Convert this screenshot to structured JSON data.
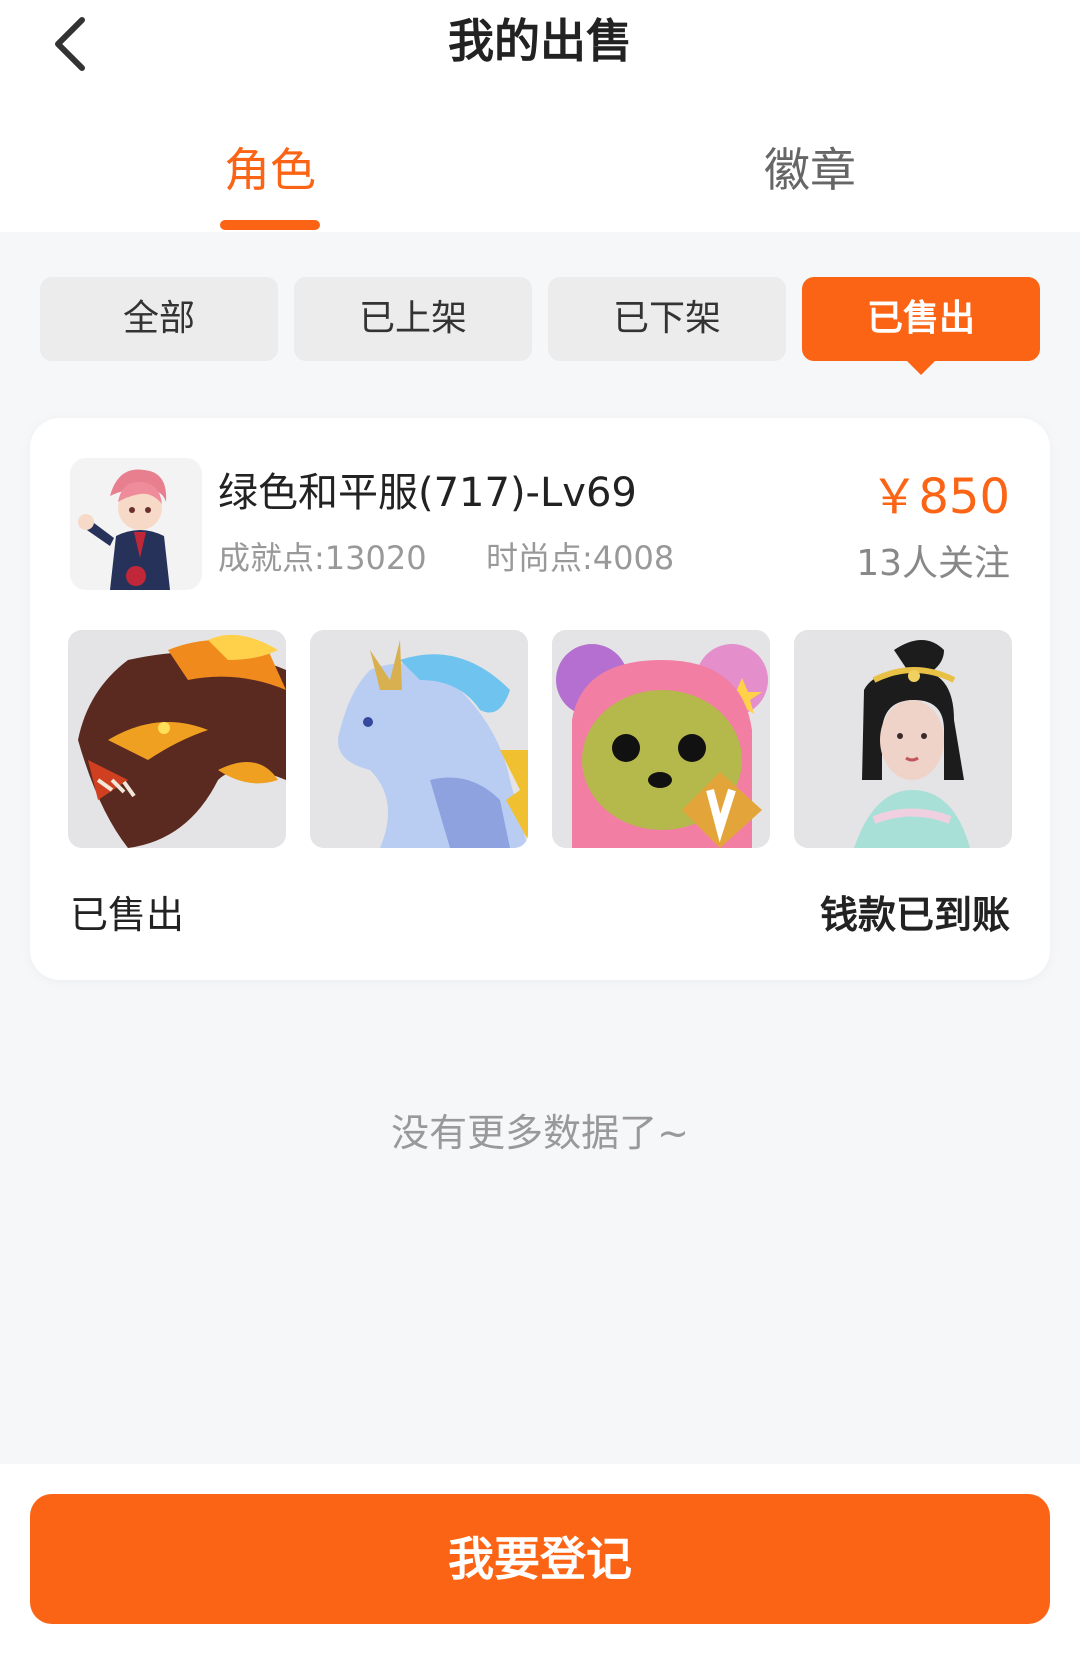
{
  "colors": {
    "accent": "#fb6414"
  },
  "header": {
    "title": "我的出售",
    "back_icon": "chevron-left-icon"
  },
  "tabs": [
    {
      "label": "角色",
      "active": true
    },
    {
      "label": "徽章",
      "active": false
    }
  ],
  "filters": [
    {
      "label": "全部",
      "active": false
    },
    {
      "label": "已上架",
      "active": false
    },
    {
      "label": "已下架",
      "active": false
    },
    {
      "label": "已售出",
      "active": true
    }
  ],
  "listing": {
    "name": "绿色和平服(717)-Lv69",
    "achievement": "成就点:13020",
    "fashion": "时尚点:4008",
    "price": "￥850",
    "followers": "13人关注",
    "status": "已售出",
    "payment_status": "钱款已到账",
    "thumbnails": [
      "dragon-mount",
      "lightning-horse-mount",
      "pink-bear-costume",
      "hanfu-hairstyle"
    ]
  },
  "list_end_text": "没有更多数据了~",
  "footer": {
    "register_label": "我要登记"
  }
}
